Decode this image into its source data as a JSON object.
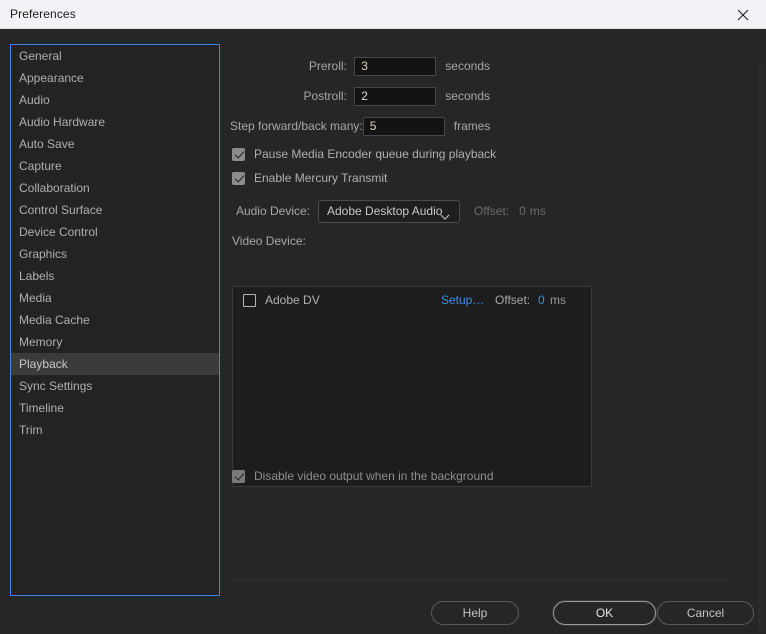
{
  "window": {
    "title": "Preferences",
    "close_icon": "close-icon"
  },
  "sidebar": {
    "items": [
      {
        "label": "General",
        "selected": false
      },
      {
        "label": "Appearance",
        "selected": false
      },
      {
        "label": "Audio",
        "selected": false
      },
      {
        "label": "Audio Hardware",
        "selected": false
      },
      {
        "label": "Auto Save",
        "selected": false
      },
      {
        "label": "Capture",
        "selected": false
      },
      {
        "label": "Collaboration",
        "selected": false
      },
      {
        "label": "Control Surface",
        "selected": false
      },
      {
        "label": "Device Control",
        "selected": false
      },
      {
        "label": "Graphics",
        "selected": false
      },
      {
        "label": "Labels",
        "selected": false
      },
      {
        "label": "Media",
        "selected": false
      },
      {
        "label": "Media Cache",
        "selected": false
      },
      {
        "label": "Memory",
        "selected": false
      },
      {
        "label": "Playback",
        "selected": true
      },
      {
        "label": "Sync Settings",
        "selected": false
      },
      {
        "label": "Timeline",
        "selected": false
      },
      {
        "label": "Trim",
        "selected": false
      }
    ],
    "focus_border_color": "#3d87e8",
    "selected_row_color": "#3b3b3b"
  },
  "main": {
    "preroll": {
      "label": "Preroll:",
      "value": "3",
      "unit": "seconds"
    },
    "postroll": {
      "label": "Postroll:",
      "value": "2",
      "unit": "seconds"
    },
    "step": {
      "label": "Step forward/back many:",
      "value": "5",
      "unit": "frames"
    },
    "pause_encoder": {
      "label": "Pause Media Encoder queue during playback",
      "checked": true
    },
    "mercury_transmit": {
      "label": "Enable Mercury Transmit",
      "checked": true
    },
    "audio_device": {
      "label": "Audio Device:",
      "value": "Adobe Desktop Audio",
      "offset_label": "Offset:",
      "offset_value": "0",
      "offset_unit": "ms",
      "disabled": true
    },
    "video_device": {
      "label": "Video Device:",
      "rows": [
        {
          "name": "Adobe DV",
          "checked": false,
          "setup_label": "Setup…",
          "offset_label": "Offset:",
          "offset_value": "0",
          "offset_unit": "ms"
        }
      ]
    },
    "disable_video_output": {
      "label": "Disable video output when in the background",
      "checked": true,
      "disabled": true
    }
  },
  "footer": {
    "help_label": "Help",
    "ok_label": "OK",
    "cancel_label": "Cancel"
  },
  "colors": {
    "link": "#3f8ce8",
    "accent_border": "#3d87e8",
    "background": "#262626",
    "titlebar": "#f3f3f7"
  }
}
